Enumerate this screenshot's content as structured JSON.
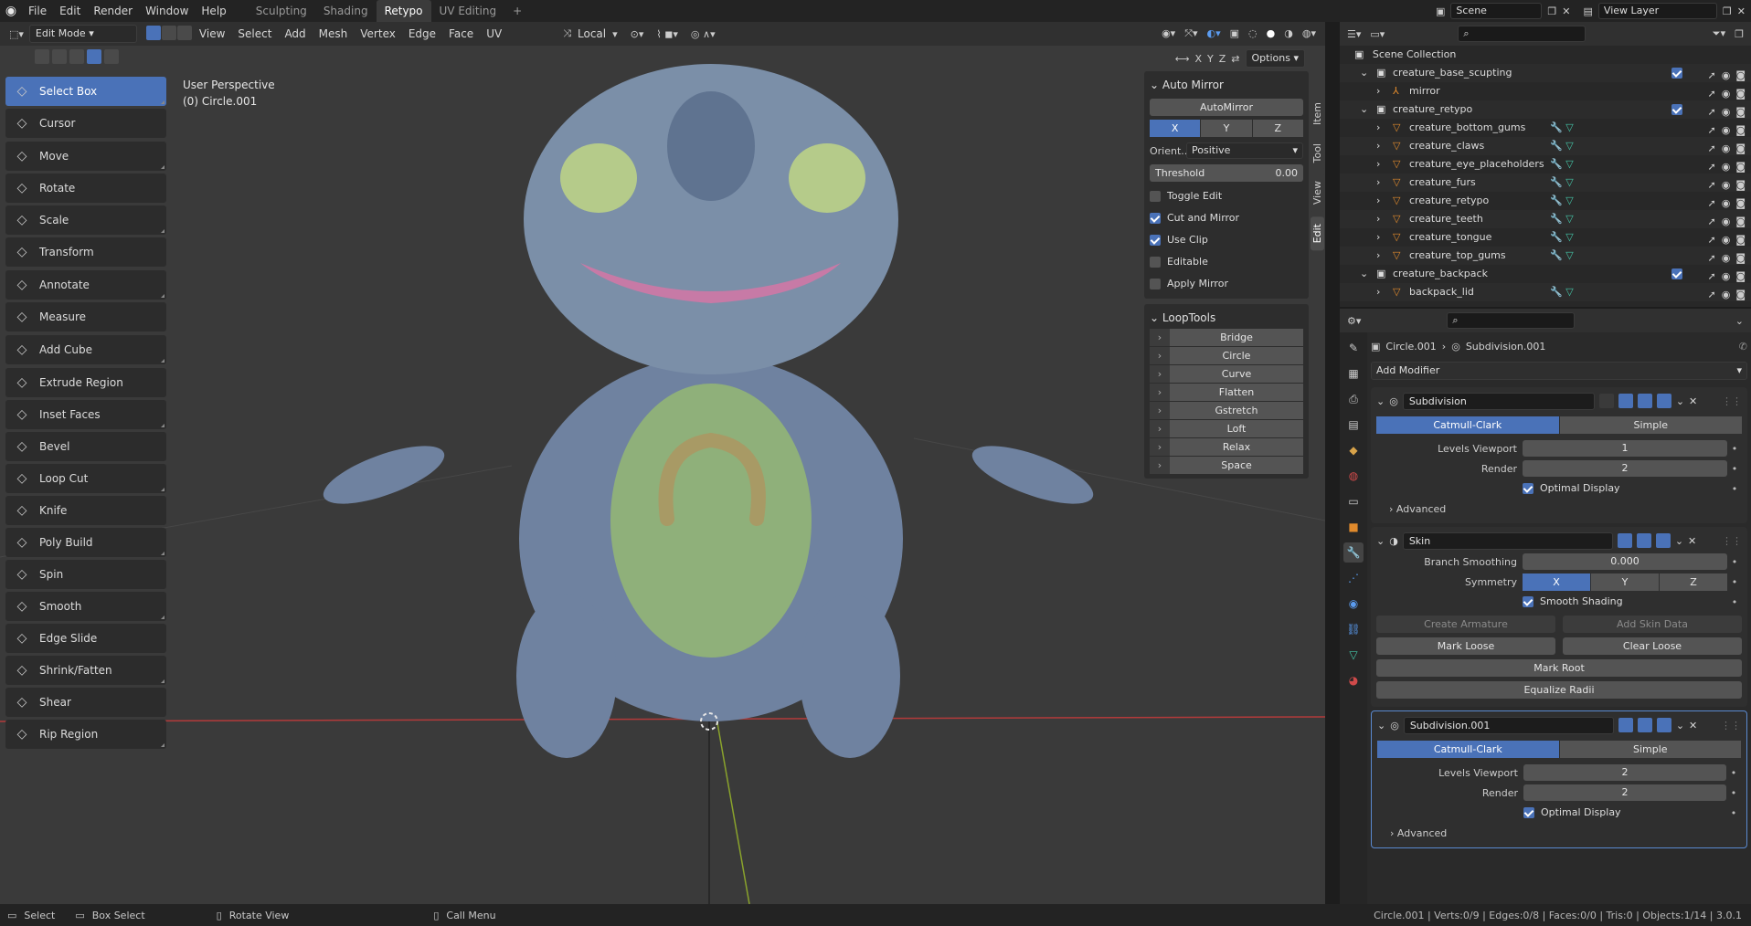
{
  "topbar": {
    "menus": [
      "File",
      "Edit",
      "Render",
      "Window",
      "Help"
    ],
    "workspaces": [
      "Sculpting",
      "Shading",
      "Retypo",
      "UV Editing"
    ],
    "active_workspace": "Retypo",
    "add_tab": "+",
    "scene": "Scene",
    "view_layer": "View Layer"
  },
  "viewport": {
    "mode": "Edit Mode",
    "menus": [
      "View",
      "Select",
      "Add",
      "Mesh",
      "Vertex",
      "Edge",
      "Face",
      "UV"
    ],
    "orientation": "Local",
    "axes": [
      "X",
      "Y",
      "Z"
    ],
    "options": "Options",
    "overlay_title": "User Perspective",
    "overlay_object": "(0) Circle.001"
  },
  "toolbar": {
    "tools": [
      {
        "label": "Select Box",
        "icon": "select-box-icon",
        "active": true
      },
      {
        "label": "Cursor",
        "icon": "cursor-icon"
      },
      {
        "label": "Move",
        "icon": "move-icon"
      },
      {
        "label": "Rotate",
        "icon": "rotate-icon"
      },
      {
        "label": "Scale",
        "icon": "scale-icon"
      },
      {
        "label": "Transform",
        "icon": "transform-icon"
      },
      {
        "label": "Annotate",
        "icon": "annotate-icon"
      },
      {
        "label": "Measure",
        "icon": "measure-icon"
      },
      {
        "label": "Add Cube",
        "icon": "add-cube-icon"
      },
      {
        "label": "Extrude Region",
        "icon": "extrude-icon"
      },
      {
        "label": "Inset Faces",
        "icon": "inset-icon"
      },
      {
        "label": "Bevel",
        "icon": "bevel-icon"
      },
      {
        "label": "Loop Cut",
        "icon": "loop-cut-icon"
      },
      {
        "label": "Knife",
        "icon": "knife-icon"
      },
      {
        "label": "Poly Build",
        "icon": "poly-build-icon"
      },
      {
        "label": "Spin",
        "icon": "spin-icon"
      },
      {
        "label": "Smooth",
        "icon": "smooth-icon"
      },
      {
        "label": "Edge Slide",
        "icon": "edge-slide-icon"
      },
      {
        "label": "Shrink/Fatten",
        "icon": "shrink-fatten-icon"
      },
      {
        "label": "Shear",
        "icon": "shear-icon"
      },
      {
        "label": "Rip Region",
        "icon": "rip-region-icon"
      }
    ]
  },
  "npanel": {
    "automirror_title": "Auto Mirror",
    "automirror_button": "AutoMirror",
    "axes": [
      "X",
      "Y",
      "Z"
    ],
    "orient_label": "Orient...",
    "orient_value": "Positive",
    "threshold_label": "Threshold",
    "threshold_value": "0.00",
    "checks": [
      {
        "label": "Toggle Edit",
        "on": false
      },
      {
        "label": "Cut and Mirror",
        "on": true
      },
      {
        "label": "Use Clip",
        "on": true
      },
      {
        "label": "Editable",
        "on": false
      },
      {
        "label": "Apply Mirror",
        "on": false
      }
    ],
    "looptools_title": "LoopTools",
    "looptools": [
      "Bridge",
      "Circle",
      "Curve",
      "Flatten",
      "Gstretch",
      "Loft",
      "Relax",
      "Space"
    ],
    "tabs": [
      "Item",
      "Tool",
      "View",
      "Edit"
    ]
  },
  "outliner": {
    "root": "Scene Collection",
    "rows": [
      {
        "name": "creature_base_scupting",
        "kind": "collection",
        "indent": 1
      },
      {
        "name": "mirror",
        "kind": "empty",
        "indent": 2
      },
      {
        "name": "creature_retypo",
        "kind": "collection",
        "indent": 1
      },
      {
        "name": "creature_bottom_gums",
        "kind": "mesh",
        "indent": 2
      },
      {
        "name": "creature_claws",
        "kind": "mesh",
        "indent": 2
      },
      {
        "name": "creature_eye_placeholders",
        "kind": "mesh",
        "indent": 2
      },
      {
        "name": "creature_furs",
        "kind": "mesh",
        "indent": 2
      },
      {
        "name": "creature_retypo",
        "kind": "mesh",
        "indent": 2
      },
      {
        "name": "creature_teeth",
        "kind": "mesh",
        "indent": 2
      },
      {
        "name": "creature_tongue",
        "kind": "mesh",
        "indent": 2
      },
      {
        "name": "creature_top_gums",
        "kind": "mesh",
        "indent": 2
      },
      {
        "name": "creature_backpack",
        "kind": "collection",
        "indent": 1
      },
      {
        "name": "backpack_lid",
        "kind": "mesh",
        "indent": 2
      }
    ]
  },
  "properties": {
    "breadcrumb_object": "Circle.001",
    "breadcrumb_modifier": "Subdivision.001",
    "add_modifier": "Add Modifier",
    "sub1": {
      "name": "Subdivision",
      "mode_a": "Catmull-Clark",
      "mode_b": "Simple",
      "levels_label": "Levels Viewport",
      "levels_value": "1",
      "render_label": "Render",
      "render_value": "2",
      "optimal": "Optimal Display",
      "advanced": "Advanced"
    },
    "skin": {
      "name": "Skin",
      "branch_label": "Branch Smoothing",
      "branch_value": "0.000",
      "symmetry_label": "Symmetry",
      "axes": [
        "X",
        "Y",
        "Z"
      ],
      "smooth": "Smooth Shading",
      "create_armature": "Create Armature",
      "add_skin_data": "Add Skin Data",
      "mark_loose": "Mark Loose",
      "clear_loose": "Clear Loose",
      "mark_root": "Mark Root",
      "equalize": "Equalize Radii"
    },
    "sub2": {
      "name": "Subdivision.001",
      "mode_a": "Catmull-Clark",
      "mode_b": "Simple",
      "levels_label": "Levels Viewport",
      "levels_value": "2",
      "render_label": "Render",
      "render_value": "2",
      "optimal": "Optimal Display",
      "advanced": "Advanced"
    }
  },
  "statusbar": {
    "select": "Select",
    "box_select": "Box Select",
    "rotate_view": "Rotate View",
    "call_menu": "Call Menu",
    "stats": "Circle.001 | Verts:0/9 | Edges:0/8 | Faces:0/0 | Tris:0 | Objects:1/14 | 3.0.1"
  },
  "colors": {
    "accent": "#4a72b8",
    "viewport_bg": "#3a3a3a",
    "creature_blue": "#7b8fa8",
    "belly_green": "#8fb07a"
  }
}
